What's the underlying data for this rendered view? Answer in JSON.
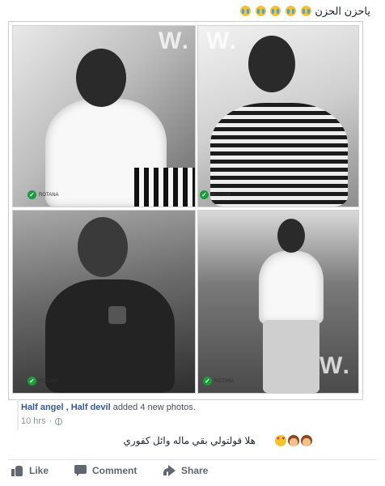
{
  "post": {
    "text": "ياحزن الحزن",
    "text_emojis": [
      "crying-face-icon",
      "crying-face-icon",
      "crying-face-icon",
      "crying-face-icon",
      "crying-face-icon"
    ]
  },
  "photos": [
    {
      "watermark": "W."
    },
    {
      "watermark": "W."
    },
    {
      "watermark": ""
    },
    {
      "watermark": "W."
    }
  ],
  "logo_text": "ROTANA",
  "attribution": {
    "author": "Half angel , Half devil",
    "action": " added 4 new photos."
  },
  "timestamp": "10 hrs",
  "timestamp_separator": "·",
  "caption": {
    "text": "هلا قولتولي بقي ماله وائل كفوري",
    "emojis": [
      "smiling-face-heart-eyes-icon",
      "person-icon",
      "person-icon"
    ]
  },
  "actions": {
    "like": "Like",
    "comment": "Comment",
    "share": "Share"
  },
  "colors": {
    "link": "#365899",
    "meta": "#90949c",
    "action": "#616770"
  }
}
